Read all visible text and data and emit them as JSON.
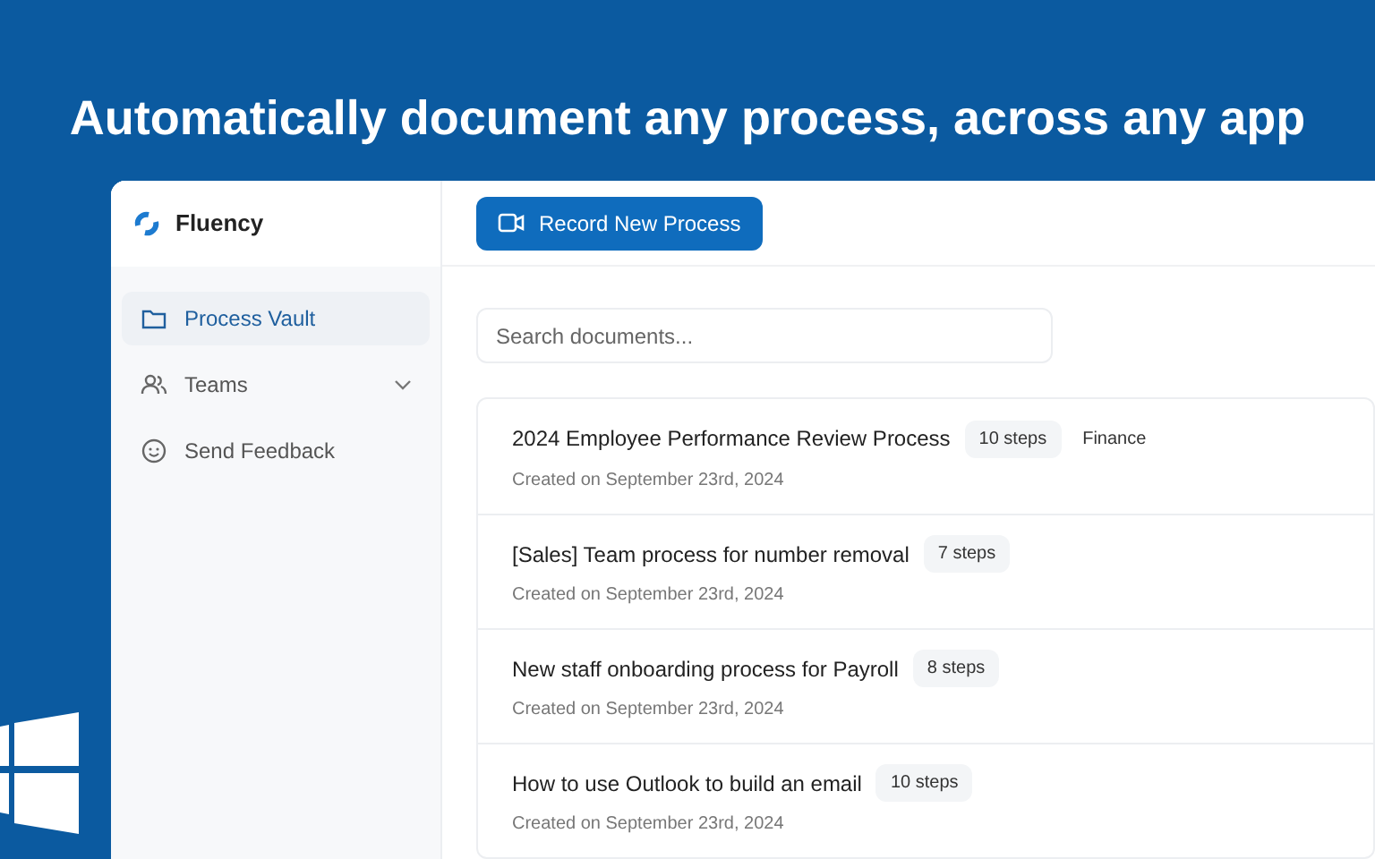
{
  "headline": "Automatically document any process, across any app",
  "app": {
    "name": "Fluency"
  },
  "sidebar": {
    "items": [
      {
        "label": "Process Vault",
        "kind": "folder",
        "selected": true,
        "expandable": false
      },
      {
        "label": "Teams",
        "kind": "people",
        "selected": false,
        "expandable": true
      },
      {
        "label": "Send Feedback",
        "kind": "smile",
        "selected": false,
        "expandable": false
      }
    ]
  },
  "toolbar": {
    "button": "Record New Process"
  },
  "search": {
    "placeholder": "Search documents..."
  },
  "documents": [
    {
      "title": "2024 Employee Performance Review Process",
      "steps": "10 steps",
      "category": "Finance",
      "created": "Created on September 23rd, 2024"
    },
    {
      "title": "[Sales] Team process for number removal",
      "steps": "7 steps",
      "created": "Created on September 23rd, 2024"
    },
    {
      "title": "New staff onboarding process for Payroll",
      "steps": "8 steps",
      "created": "Created on September 23rd, 2024"
    },
    {
      "title": "How to use Outlook to build an email",
      "steps": "10 steps",
      "created": "Created on September 23rd, 2024"
    }
  ]
}
